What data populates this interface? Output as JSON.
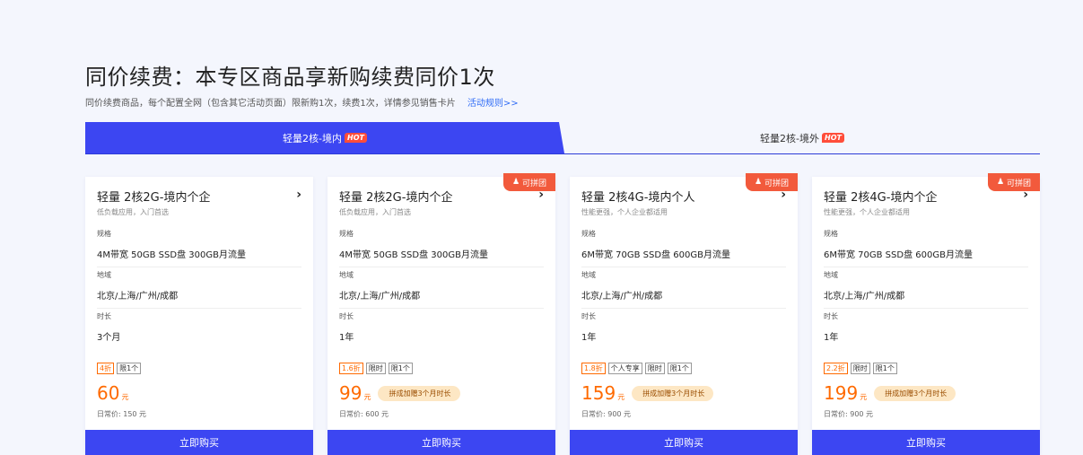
{
  "header": {
    "title": "同价续费：本专区商品享新购续费同价1次",
    "subtitle": "同价续费商品，每个配置全网（包含其它活动页面）限新购1次，续费1次，详情参见销售卡片",
    "rules_link": "活动规则>>"
  },
  "tabs": [
    {
      "label": "轻量2核-境内",
      "badge": "HOT",
      "active": true
    },
    {
      "label": "轻量2核-境外",
      "badge": "HOT",
      "active": false
    }
  ],
  "labels": {
    "spec": "规格",
    "region": "地域",
    "duration": "时长",
    "buy_button": "立即购买",
    "group_badge": "可拼团",
    "arrow": "›"
  },
  "cards": [
    {
      "name": "轻量 2核2G-境内个企",
      "desc": "低负载应用，入门首选",
      "spec": "4M带宽 50GB SSD盘 300GB月流量",
      "region": "北京/上海/广州/成都",
      "duration": "3个月",
      "tags": [
        "4折",
        "限1个"
      ],
      "price": "60",
      "unit": "元",
      "promo": "",
      "original": "日常价: 150 元",
      "group": false
    },
    {
      "name": "轻量 2核2G-境内个企",
      "desc": "低负载应用，入门首选",
      "spec": "4M带宽 50GB SSD盘 300GB月流量",
      "region": "北京/上海/广州/成都",
      "duration": "1年",
      "tags": [
        "1.6折",
        "限时",
        "限1个"
      ],
      "price": "99",
      "unit": "元",
      "promo": "拼成加赠3个月时长",
      "original": "日常价: 600 元",
      "group": true
    },
    {
      "name": "轻量 2核4G-境内个人",
      "desc": "性能更强，个人企业都适用",
      "spec": "6M带宽 70GB SSD盘 600GB月流量",
      "region": "北京/上海/广州/成都",
      "duration": "1年",
      "tags": [
        "1.8折",
        "个人专享",
        "限时",
        "限1个"
      ],
      "price": "159",
      "unit": "元",
      "promo": "拼成加赠3个月时长",
      "original": "日常价: 900 元",
      "group": true
    },
    {
      "name": "轻量 2核4G-境内个企",
      "desc": "性能更强，个人企业都适用",
      "spec": "6M带宽 70GB SSD盘 600GB月流量",
      "region": "北京/上海/广州/成都",
      "duration": "1年",
      "tags": [
        "2.2折",
        "限时",
        "限1个"
      ],
      "price": "199",
      "unit": "元",
      "promo": "拼成加赠3个月时长",
      "original": "日常价: 900 元",
      "group": true
    }
  ]
}
